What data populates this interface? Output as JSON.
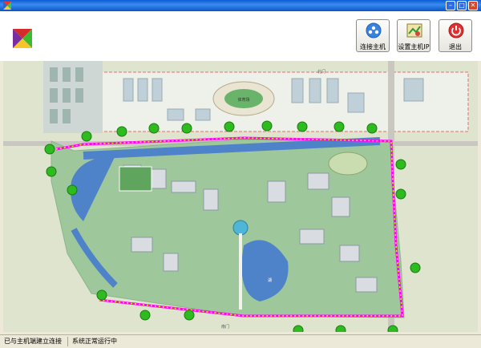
{
  "toolbar": {
    "connect_label": "连接主机",
    "set_ip_label": "设置主机IP",
    "exit_label": "退出"
  },
  "map": {
    "labels": {
      "stadium": "体育场",
      "lake": "湖",
      "north_gate": "北门",
      "south_gate": "南门"
    }
  },
  "status": {
    "connection": "已与主机端建立连接",
    "system": "系统正常运行中"
  },
  "colors": {
    "perimeter": "#ff00ff",
    "sensor_light": "#ffee00",
    "node": "#2dbb1f",
    "water": "#4f83c9",
    "grass": "#8fc48a"
  }
}
